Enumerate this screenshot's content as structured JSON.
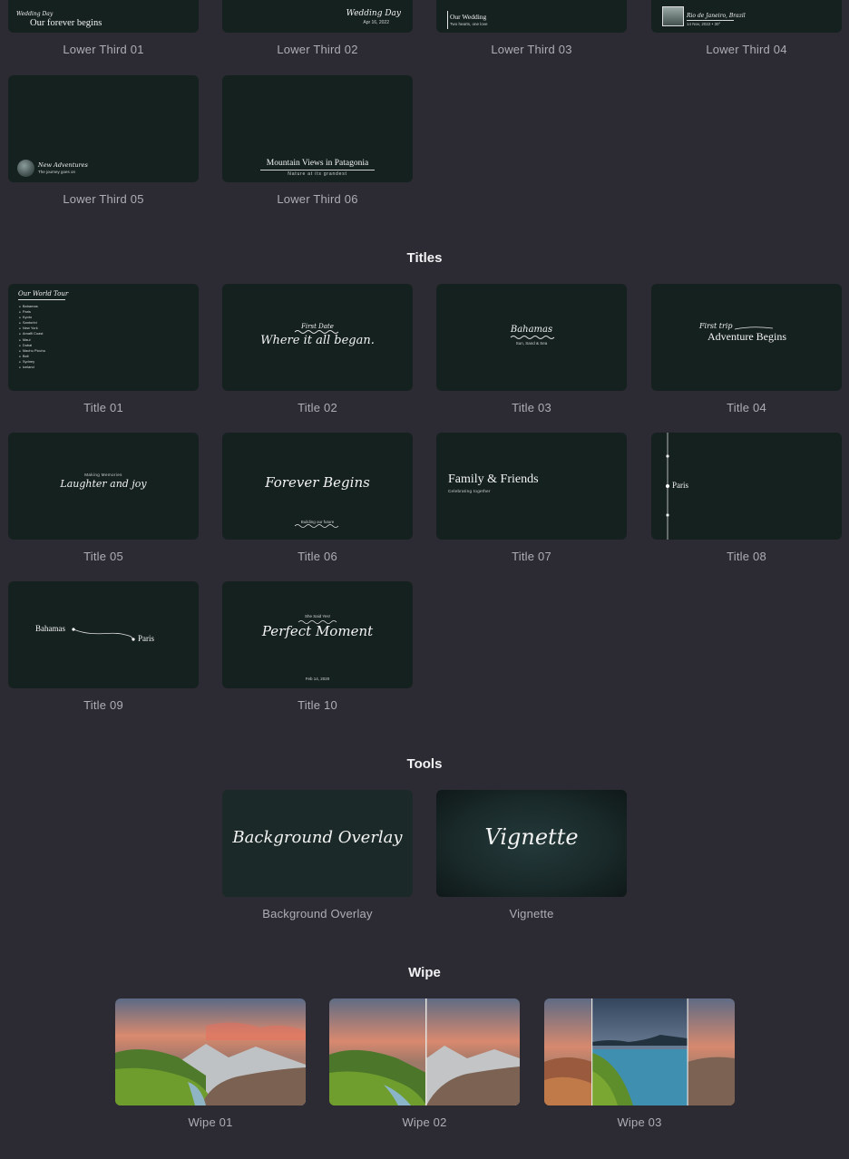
{
  "lower_thirds": [
    {
      "caption": "Lower Third 01",
      "t1": "Wedding Day",
      "t2": "Our forever begins"
    },
    {
      "caption": "Lower Third 02",
      "t1": "Wedding Day",
      "t2": "Apr 16, 2022"
    },
    {
      "caption": "Lower Third 03",
      "t1": "Our Wedding",
      "t2": "Two hearts, one love"
    },
    {
      "caption": "Lower Third 04",
      "t1": "Rio de Janeiro, Brazil",
      "t2": "14 Nov, 2022 • 30°"
    },
    {
      "caption": "Lower Third 05",
      "t1": "New Adventures",
      "t2": "The journey goes on"
    },
    {
      "caption": "Lower Third 06",
      "t1": "Mountain Views in Patagonia",
      "t2": "Nature at its grandest"
    }
  ],
  "sections": {
    "titles": "Titles",
    "tools": "Tools",
    "wipe": "Wipe"
  },
  "titles": [
    {
      "caption": "Title 01",
      "heading": "Our World Tour",
      "list": [
        "Bahamas",
        "Paris",
        "Kyoto",
        "Santorini",
        "New York",
        "Amalfi Coast",
        "Maui",
        "Dubai",
        "Machu Picchu",
        "Bali",
        "Sydney",
        "Iceland"
      ]
    },
    {
      "caption": "Title 02",
      "t1": "First Date",
      "t2": "Where it all began."
    },
    {
      "caption": "Title 03",
      "t1": "Bahamas",
      "t2": "Sun, Sand & Sea"
    },
    {
      "caption": "Title 04",
      "t1": "First trip",
      "t2": "Adventure Begins"
    },
    {
      "caption": "Title 05",
      "t1": "Making Memories",
      "t2": "Laughter and joy"
    },
    {
      "caption": "Title 06",
      "t1": "Forever Begins",
      "t2": "Building our future"
    },
    {
      "caption": "Title 07",
      "t1": "Family & Friends",
      "t2": "Celebrating together"
    },
    {
      "caption": "Title 08",
      "t1": "Paris"
    },
    {
      "caption": "Title 09",
      "t1": "Bahamas",
      "t2": "Paris"
    },
    {
      "caption": "Title 10",
      "t1": "She Said Yes!",
      "t2": "Perfect Moment",
      "t3": "Feb 14, 2020"
    }
  ],
  "tools": [
    {
      "caption": "Background Overlay",
      "text": "Background Overlay"
    },
    {
      "caption": "Vignette",
      "text": "Vignette"
    }
  ],
  "wipes": [
    {
      "caption": "Wipe 01"
    },
    {
      "caption": "Wipe 02"
    },
    {
      "caption": "Wipe 03"
    }
  ],
  "colors": {
    "background": "#2c2b33",
    "thumbnail": "#15211f",
    "heading": "#f2f2f4",
    "caption": "#aeadb5"
  }
}
